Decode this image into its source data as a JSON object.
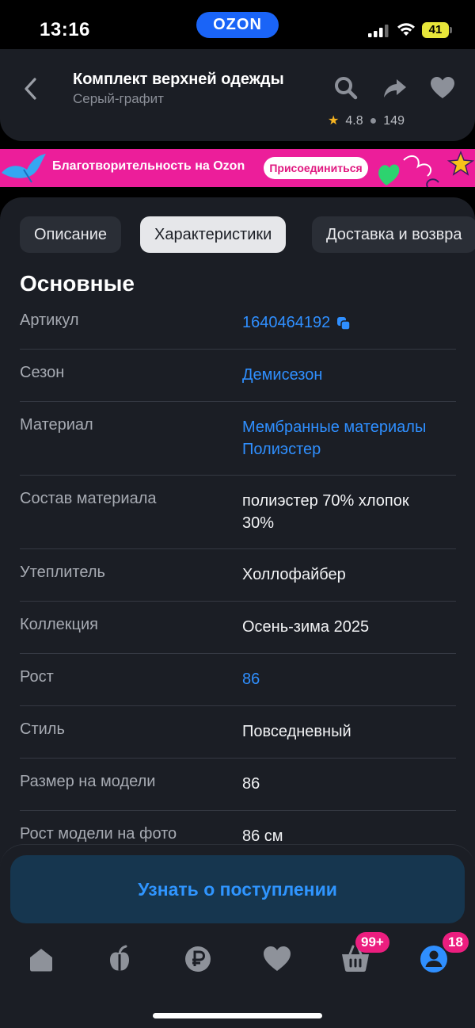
{
  "status_bar": {
    "time": "13:16",
    "brand": "OZON",
    "battery": "41"
  },
  "header": {
    "title": "Комплект верхней одежды",
    "subtitle": "Серый-графит",
    "rating": "4.8",
    "reviews": "149"
  },
  "banner": {
    "text": "Благотворительность на Ozon",
    "button": "Присоединиться"
  },
  "tabs": [
    {
      "label": "Описание",
      "active": false
    },
    {
      "label": "Характеристики",
      "active": true
    },
    {
      "label": "Доставка и возвра",
      "active": false
    }
  ],
  "section": {
    "title": "Основные"
  },
  "specs": [
    {
      "label": "Артикул",
      "value": "1640464192",
      "link": true
    },
    {
      "label": "Сезон",
      "value": "Демисезон",
      "link": true
    },
    {
      "label": "Материал",
      "value": "Мембранные материалы\nПолиэстер",
      "link": true
    },
    {
      "label": "Состав материала",
      "value": "полиэстер 70% хлопок 30%",
      "link": false
    },
    {
      "label": "Утеплитель",
      "value": "Холлофайбер",
      "link": false
    },
    {
      "label": "Коллекция",
      "value": "Осень-зима 2025",
      "link": false
    },
    {
      "label": "Рост",
      "value": "86",
      "link": true
    },
    {
      "label": "Стиль",
      "value": "Повседневный",
      "link": false
    },
    {
      "label": "Размер на модели",
      "value": "86",
      "link": false
    },
    {
      "label": "Рост модели на фото",
      "value": "86 см",
      "link": false
    }
  ],
  "cta": {
    "label": "Узнать о поступлении"
  },
  "nav": {
    "cart_badge": "99+",
    "profile_badge": "18"
  },
  "colors": {
    "accent": "#2f8fff",
    "brand": "#1a64f7",
    "pink": "#ec1e9a",
    "background": "#1b1e25"
  }
}
